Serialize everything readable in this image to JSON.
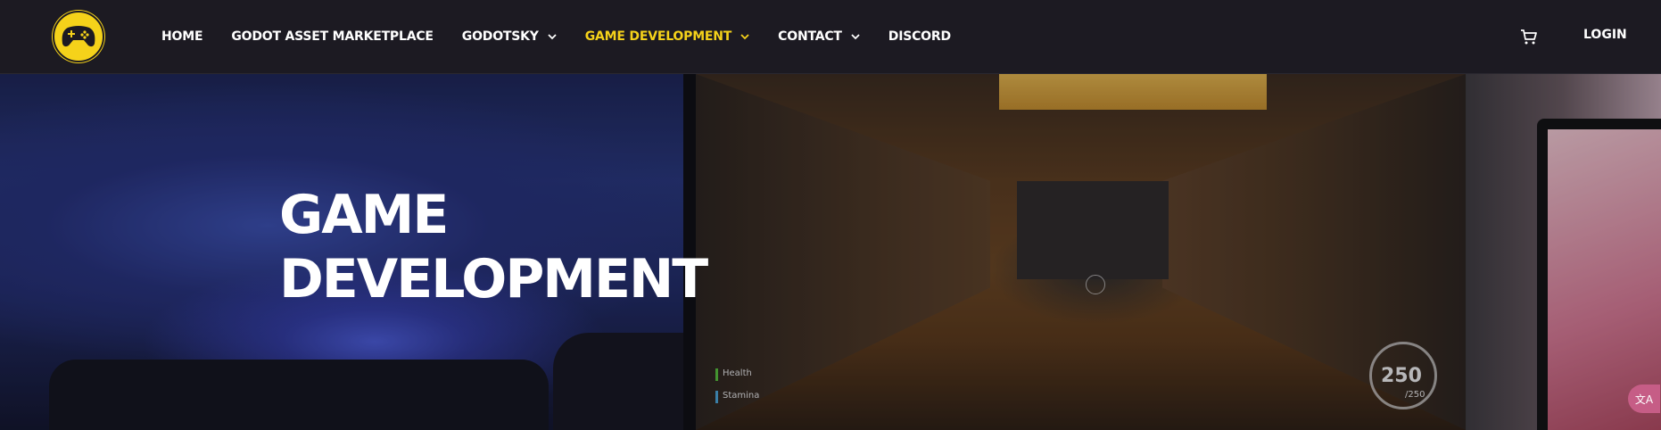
{
  "header": {
    "logo_icon": "gamepad-logo-icon",
    "nav": [
      {
        "label": "HOME",
        "has_dropdown": false,
        "active": false
      },
      {
        "label": "GODOT ASSET MARKETPLACE",
        "has_dropdown": false,
        "active": false
      },
      {
        "label": "GODOTSKY",
        "has_dropdown": true,
        "active": false
      },
      {
        "label": "GAME DEVELOPMENT",
        "has_dropdown": true,
        "active": true
      },
      {
        "label": "CONTACT",
        "has_dropdown": true,
        "active": false
      },
      {
        "label": "DISCORD",
        "has_dropdown": false,
        "active": false
      }
    ],
    "cart_icon": "cart-icon",
    "login_label": "LOGIN"
  },
  "hero": {
    "title": "GAME\nDEVELOPMENT",
    "game_hud": {
      "health_label": "Health",
      "stamina_label": "Stamina",
      "ammo_current": "250",
      "ammo_max": "/250"
    }
  },
  "colors": {
    "accent": "#f5d21a",
    "header_bg": "#1c1a22",
    "text": "#ffffff"
  }
}
